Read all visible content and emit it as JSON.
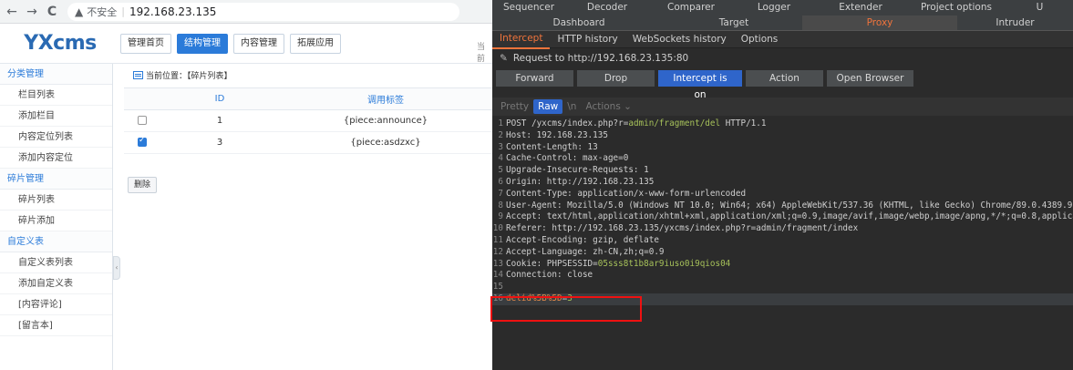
{
  "browser": {
    "back": "←",
    "forward": "→",
    "reload": "C",
    "security_icon": "warning-icon",
    "security_label": "不安全",
    "url": "192.168.23.135"
  },
  "app": {
    "logo": "YXcms",
    "topnav": [
      "管理首页",
      "结构管理",
      "内容管理",
      "拓展应用"
    ],
    "topnav_active_index": 1,
    "current_cut": "当前",
    "sidebar": [
      {
        "type": "head",
        "label": "分类管理"
      },
      {
        "type": "item",
        "label": "栏目列表"
      },
      {
        "type": "item",
        "label": "添加栏目"
      },
      {
        "type": "item",
        "label": "内容定位列表"
      },
      {
        "type": "item",
        "label": "添加内容定位"
      },
      {
        "type": "head",
        "label": "碎片管理"
      },
      {
        "type": "item",
        "label": "碎片列表"
      },
      {
        "type": "item",
        "label": "碎片添加"
      },
      {
        "type": "head",
        "label": "自定义表"
      },
      {
        "type": "item",
        "label": "自定义表列表"
      },
      {
        "type": "item",
        "label": "添加自定义表"
      },
      {
        "type": "item",
        "label": "[内容评论]"
      },
      {
        "type": "item",
        "label": "[留言本]"
      }
    ],
    "collapse_glyph": "‹",
    "breadcrumb": "当前位置：【碎片列表】",
    "table": {
      "headers": [
        "",
        "ID",
        "调用标签"
      ],
      "rows": [
        {
          "checked": false,
          "id": "1",
          "tag": "{piece:announce}"
        },
        {
          "checked": true,
          "id": "3",
          "tag": "{piece:asdzxc}"
        }
      ]
    },
    "delete_button": "删除"
  },
  "burp": {
    "top_tabs_row1": [
      "Sequencer",
      "Decoder",
      "Comparer",
      "Logger",
      "Extender",
      "Project options",
      "U"
    ],
    "top_tabs_row2": [
      "Dashboard",
      "Target",
      "Proxy",
      "Intruder"
    ],
    "top_tabs_row2_active": "Proxy",
    "sub_tabs": [
      "Intercept",
      "HTTP history",
      "WebSockets history",
      "Options"
    ],
    "sub_tabs_active": "Intercept",
    "request_label": "Request to http://192.168.23.135:80",
    "buttons": [
      "Forward",
      "Drop",
      "Intercept is on",
      "Action",
      "Open Browser"
    ],
    "buttons_highlight": "Intercept is on",
    "view_tabs": [
      "Pretty",
      "Raw",
      "\\n",
      "Actions ⌄"
    ],
    "view_tabs_active": "Raw",
    "lines": [
      {
        "n": "1",
        "parts": [
          [
            "POST /yxcms/index.php?r=",
            ""
          ],
          [
            "admin/fragment/del",
            "green"
          ],
          [
            " HTTP/1.1",
            ""
          ]
        ]
      },
      {
        "n": "2",
        "parts": [
          [
            "Host: 192.168.23.135",
            ""
          ]
        ]
      },
      {
        "n": "3",
        "parts": [
          [
            "Content-Length: 13",
            ""
          ]
        ]
      },
      {
        "n": "4",
        "parts": [
          [
            "Cache-Control: max-age=0",
            ""
          ]
        ]
      },
      {
        "n": "5",
        "parts": [
          [
            "Upgrade-Insecure-Requests: 1",
            ""
          ]
        ]
      },
      {
        "n": "6",
        "parts": [
          [
            "Origin: http://192.168.23.135",
            ""
          ]
        ]
      },
      {
        "n": "7",
        "parts": [
          [
            "Content-Type: application/x-www-form-urlencoded",
            ""
          ]
        ]
      },
      {
        "n": "8",
        "parts": [
          [
            "User-Agent: Mozilla/5.0 (Windows NT 10.0; Win64; x64) AppleWebKit/537.36 (KHTML, like Gecko) Chrome/89.0.4389.9",
            ""
          ]
        ]
      },
      {
        "n": "9",
        "parts": [
          [
            "Accept: text/html,application/xhtml+xml,application/xml;q=0.9,image/avif,image/webp,image/apng,*/*;q=0.8,applica",
            ""
          ]
        ]
      },
      {
        "n": "10",
        "parts": [
          [
            "Referer: http://192.168.23.135/yxcms/index.php?r=admin/fragment/index",
            ""
          ]
        ]
      },
      {
        "n": "11",
        "parts": [
          [
            "Accept-Encoding: gzip, deflate",
            ""
          ]
        ]
      },
      {
        "n": "12",
        "parts": [
          [
            "Accept-Language: zh-CN,zh;q=0.9",
            ""
          ]
        ]
      },
      {
        "n": "13",
        "parts": [
          [
            "Cookie: PHPSESSID=",
            ""
          ],
          [
            "05sss8t1b8ar9iuso0i9qios04",
            "green"
          ]
        ]
      },
      {
        "n": "14",
        "parts": [
          [
            "Connection: close",
            ""
          ]
        ]
      },
      {
        "n": "15",
        "parts": [
          [
            "",
            ""
          ]
        ]
      },
      {
        "n": "16",
        "parts": [
          [
            "delid%5B%5D",
            "orange"
          ],
          [
            "=",
            ""
          ],
          [
            "3",
            "green"
          ]
        ]
      }
    ]
  }
}
